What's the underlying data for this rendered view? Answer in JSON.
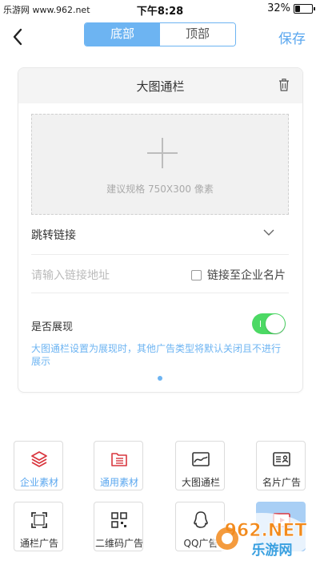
{
  "status": {
    "site": "乐游网 www.962.net",
    "time": "下午8:28",
    "battery": "32%",
    "battery_level": 0.32
  },
  "nav": {
    "tabs": [
      {
        "label": "底部",
        "active": true
      },
      {
        "label": "顶部",
        "active": false
      }
    ],
    "save_label": "保存"
  },
  "card": {
    "title": "大图通栏",
    "upload_hint": "建议规格 750X300 像素",
    "link_label": "跳转链接",
    "link_placeholder": "请输入链接地址",
    "link_card_label": "链接至企业名片",
    "display_label": "是否展现",
    "display_on": true,
    "note": "大图通栏设置为展现时，其他广告类型将默认关闭且不进行展示"
  },
  "tools": [
    {
      "label": "企业素材",
      "icon": "layers-icon"
    },
    {
      "label": "通用素材",
      "icon": "folder-icon"
    },
    {
      "label": "大图通栏",
      "icon": "image-banner-icon"
    },
    {
      "label": "名片广告",
      "icon": "business-card-icon"
    },
    {
      "label": "通栏广告",
      "icon": "frame-icon"
    },
    {
      "label": "二维码广告",
      "icon": "qr-code-icon"
    },
    {
      "label": "QQ广告",
      "icon": "qq-icon"
    },
    {
      "label": "",
      "icon": "video-icon"
    }
  ],
  "watermark": {
    "line1": "962.NET",
    "line2": "乐游网"
  },
  "colors": {
    "accent": "#5aa7ef",
    "toggle_on": "#4cd964",
    "icon_red": "#d9363e"
  }
}
